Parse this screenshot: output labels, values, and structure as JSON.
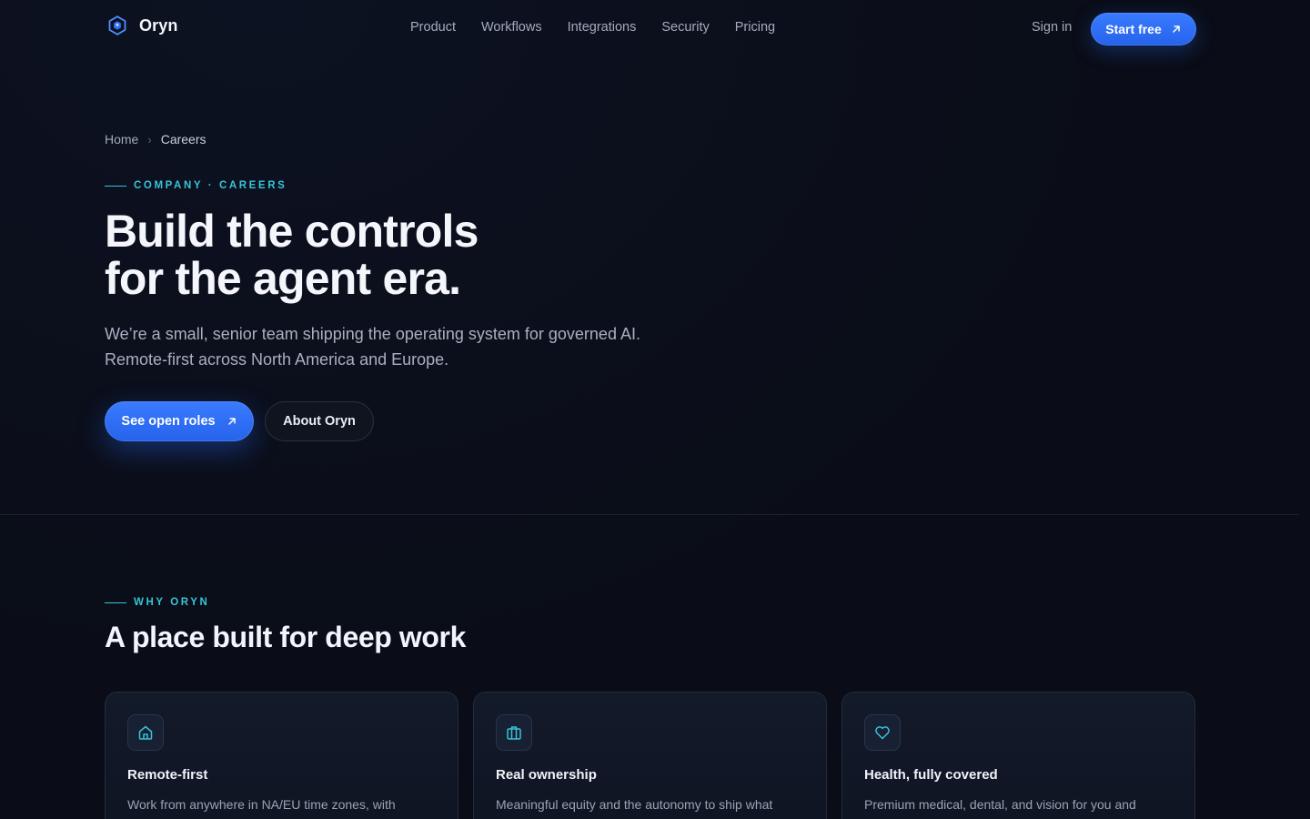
{
  "nav": {
    "brand": "Oryn",
    "links": [
      "Product",
      "Workflows",
      "Integrations",
      "Security",
      "Pricing"
    ],
    "sign_in": "Sign in",
    "start_free": "Start free"
  },
  "hero": {
    "breadcrumb": {
      "home": "Home",
      "separator": "›",
      "current": "Careers"
    },
    "eyebrow": "COMPANY · CAREERS",
    "title_line1": "Build the controls",
    "title_line2": "for the agent era.",
    "subtitle_line1": "We’re a small, senior team shipping the operating system for governed AI.",
    "subtitle_line2": "Remote-first across North America and Europe.",
    "primary_cta": "See open roles",
    "secondary_cta": "About Oryn"
  },
  "why": {
    "eyebrow": "WHY ORYN",
    "title": "A place built for deep work",
    "cards": [
      {
        "icon": "home-icon",
        "title": "Remote-first",
        "description": "Work from anywhere in NA/EU time zones, with"
      },
      {
        "icon": "briefcase-icon",
        "title": "Real ownership",
        "description": "Meaningful equity and the autonomy to ship what"
      },
      {
        "icon": "heart-icon",
        "title": "Health, fully covered",
        "description": "Premium medical, dental, and vision for you and"
      }
    ]
  },
  "colors": {
    "background": "#0a0d17",
    "accent_blue": "#2563eb",
    "accent_cyan": "#38c4d8",
    "text_primary": "#f2f5fb",
    "text_muted": "#a3abbd"
  }
}
